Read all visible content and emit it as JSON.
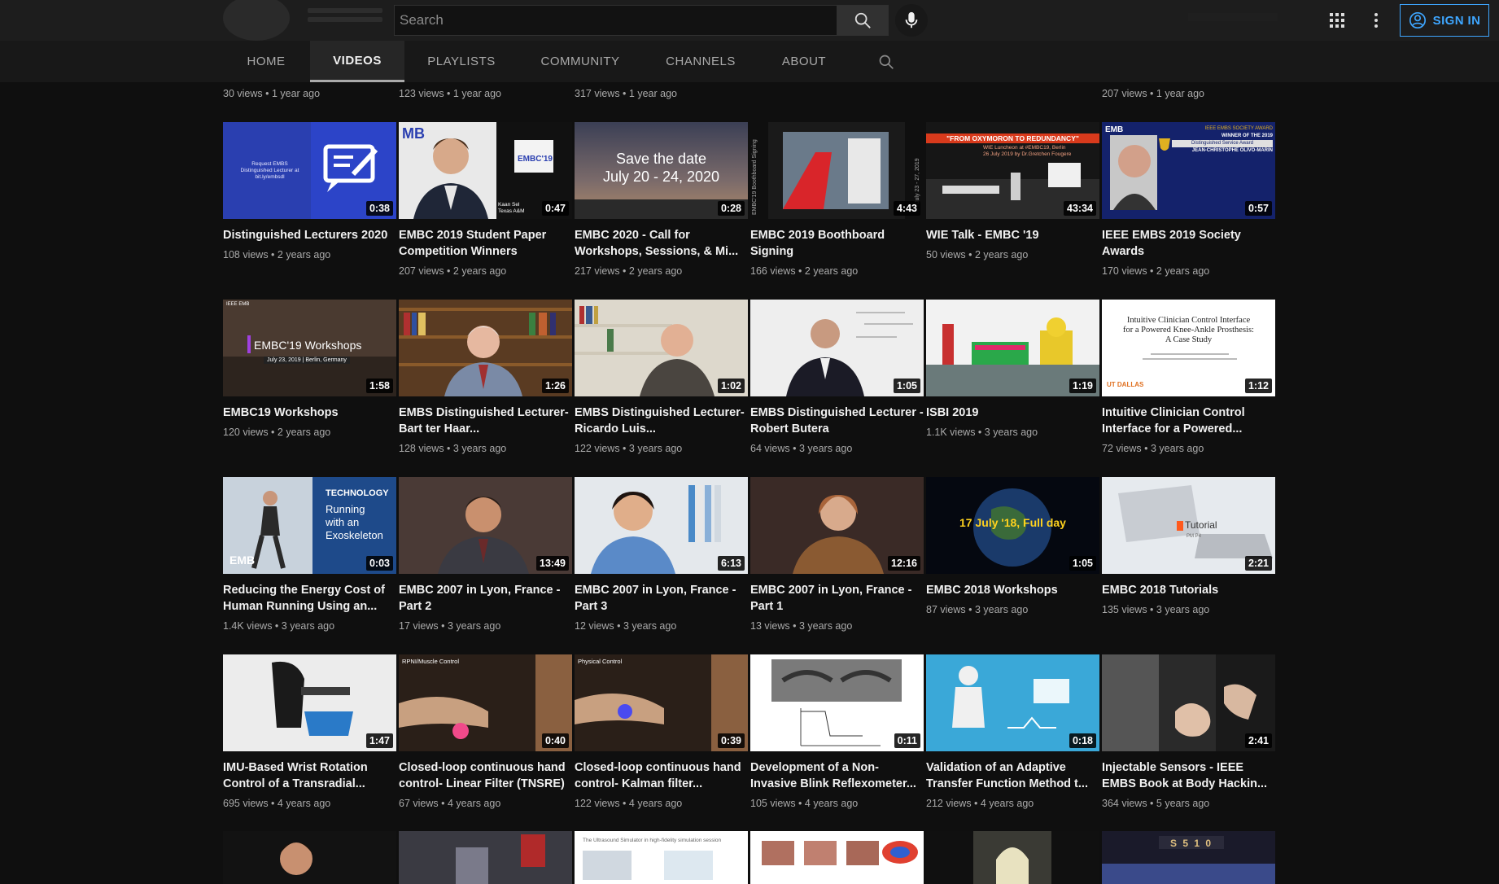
{
  "header": {
    "search_placeholder": "Search",
    "sign_in_label": "SIGN IN",
    "accent_color": "#3ea6ff"
  },
  "tabs": [
    {
      "label": "HOME",
      "active": false
    },
    {
      "label": "VIDEOS",
      "active": true
    },
    {
      "label": "PLAYLISTS",
      "active": false
    },
    {
      "label": "COMMUNITY",
      "active": false
    },
    {
      "label": "CHANNELS",
      "active": false
    },
    {
      "label": "ABOUT",
      "active": false
    }
  ],
  "top_row_meta": [
    "30 views • 1 year ago",
    "123 views • 1 year ago",
    "317 views • 1 year ago",
    "",
    "",
    "207 views • 1 year ago"
  ],
  "videos": [
    {
      "title": "Distinguished Lecturers 2020",
      "meta": "108 views • 2 years ago",
      "duration": "0:38",
      "thumb_text": [
        "Request EMBS",
        "Distinguished Lecturer at",
        "bit.ly/embsdl"
      ],
      "icon": "chat-edit-icon"
    },
    {
      "title": "EMBC 2019 Student Paper Competition Winners",
      "meta": "207 views • 2 years ago",
      "duration": "0:47",
      "thumb_text": [
        "MB",
        "EMBC'19",
        "Kaan Sel",
        "Texas A&M"
      ],
      "icon": "person-portrait-icon"
    },
    {
      "title": "EMBC 2020 - Call for Workshops, Sessions, & Mi...",
      "meta": "217 views • 2 years ago",
      "duration": "0:28",
      "thumb_text": [
        "Save the date",
        "July 20 - 24, 2020"
      ],
      "icon": "sunset-icon"
    },
    {
      "title": "EMBC 2019 Boothboard Signing",
      "meta": "166 views • 2 years ago",
      "duration": "4:43",
      "thumb_text": [
        "EMBC'19 Boothboard Signing",
        "July 23 - 27, 2019",
        "Berlin"
      ],
      "icon": "red-carpet-icon"
    },
    {
      "title": "WIE Talk - EMBC '19",
      "meta": "50 views • 2 years ago",
      "duration": "43:34",
      "thumb_text": [
        "\"FROM OXYMORON TO REDUNDANCY\"",
        "WIE Luncheon at #EMBC19, Berlin",
        "26 July 2019 by Dr.Gretchen Fougere"
      ],
      "icon": "stage-icon"
    },
    {
      "title": "IEEE EMBS 2019 Society Awards",
      "meta": "170 views • 2 years ago",
      "duration": "0:57",
      "thumb_text": [
        "EMB",
        "IEEE EMBS SOCIETY AWARD",
        "WINNER OF THE 2019",
        "Distinguished Service Award",
        "JEAN-CHRISTOPHE OLIVO-MARIN"
      ],
      "icon": "trophy-icon"
    },
    {
      "title": "EMBC19 Workshops",
      "meta": "120 views • 2 years ago",
      "duration": "1:58",
      "thumb_text": [
        "IEEE EMB",
        "EMBC'19 Workshops",
        "July 23, 2019 | Berlin, Germany"
      ],
      "icon": "workshop-icon"
    },
    {
      "title": "EMBS Distinguished Lecturer- Bart ter Haar...",
      "meta": "128 views • 3 years ago",
      "duration": "1:26",
      "thumb_text": [],
      "icon": "bookshelf-portrait-icon"
    },
    {
      "title": "EMBS Distinguished Lecturer- Ricardo Luis...",
      "meta": "122 views • 3 years ago",
      "duration": "1:02",
      "thumb_text": [],
      "icon": "bookshelf-portrait-icon"
    },
    {
      "title": "EMBS Distinguished Lecturer - Robert Butera",
      "meta": "64 views • 3 years ago",
      "duration": "1:05",
      "thumb_text": [],
      "icon": "whiteboard-portrait-icon"
    },
    {
      "title": "ISBI 2019",
      "meta": "1.1K views • 3 years ago",
      "duration": "1:19",
      "thumb_text": [],
      "icon": "venice-icon"
    },
    {
      "title": "Intuitive Clinician Control Interface for a Powered...",
      "meta": "72 views • 3 years ago",
      "duration": "1:12",
      "thumb_text": [
        "Intuitive Clinician Control Interface",
        "for a Powered Knee-Ankle Prosthesis:",
        "A Case Study",
        "UT DALLAS"
      ],
      "icon": "paper-title-icon"
    },
    {
      "title": "Reducing the Energy Cost of Human Running Using an...",
      "meta": "1.4K views • 3 years ago",
      "duration": "0:03",
      "thumb_text": [
        "TECHNOLOGY",
        "Running",
        "with an",
        "Exoskeleton",
        "EMB"
      ],
      "icon": "runner-icon"
    },
    {
      "title": "EMBC 2007 in Lyon, France - Part 2",
      "meta": "17 views • 3 years ago",
      "duration": "13:49",
      "thumb_text": [],
      "icon": "interview-icon"
    },
    {
      "title": "EMBC 2007 in Lyon, France - Part 3",
      "meta": "12 views • 3 years ago",
      "duration": "6:13",
      "thumb_text": [],
      "icon": "doctor-icon"
    },
    {
      "title": "EMBC 2007 in Lyon, France - Part 1",
      "meta": "13 views • 3 years ago",
      "duration": "12:16",
      "thumb_text": [],
      "icon": "interview-icon"
    },
    {
      "title": "EMBC 2018 Workshops",
      "meta": "87 views • 3 years ago",
      "duration": "1:05",
      "thumb_text": [
        "17 July '18, Full day"
      ],
      "icon": "globe-icon"
    },
    {
      "title": "EMBC 2018 Tutorials",
      "meta": "135 views • 3 years ago",
      "duration": "2:21",
      "thumb_text": [
        "Tutorial",
        "PM P4"
      ],
      "icon": "laptop-icon"
    },
    {
      "title": "IMU-Based Wrist Rotation Control of a Transradial...",
      "meta": "695 views • 4 years ago",
      "duration": "1:47",
      "thumb_text": [],
      "icon": "prosthesis-icon"
    },
    {
      "title": "Closed-loop continuous hand control- Linear Filter (TNSRE)",
      "meta": "67 views • 4 years ago",
      "duration": "0:40",
      "thumb_text": [
        "RPNI/Muscle Control"
      ],
      "icon": "hand-control-icon"
    },
    {
      "title": "Closed-loop continuous hand control- Kalman filter...",
      "meta": "122 views • 4 years ago",
      "duration": "0:39",
      "thumb_text": [
        "Physical Control"
      ],
      "icon": "hand-control-icon"
    },
    {
      "title": "Development of a Non-Invasive Blink Reflexometer...",
      "meta": "105 views • 4 years ago",
      "duration": "0:11",
      "thumb_text": [],
      "icon": "eye-graph-icon"
    },
    {
      "title": "Validation of an Adaptive Transfer Function Method t...",
      "meta": "212 views • 4 years ago",
      "duration": "0:18",
      "thumb_text": [],
      "icon": "body-model-icon"
    },
    {
      "title": "Injectable Sensors - IEEE EMBS Book at Body Hackin...",
      "meta": "364 views • 5 years ago",
      "duration": "2:41",
      "thumb_text": [],
      "icon": "hands-icon"
    }
  ],
  "partial_row": [
    {
      "icon": "person-portrait-icon",
      "text": ""
    },
    {
      "icon": "lab-icon",
      "text": ""
    },
    {
      "icon": "slide-icon",
      "text": "The Ultrasound Simulator in high-fidelity simulation session"
    },
    {
      "icon": "diagram-icon",
      "text": ""
    },
    {
      "icon": "arch-icon",
      "text": ""
    },
    {
      "icon": "stage-icon",
      "text": "S 5 1 0"
    }
  ]
}
